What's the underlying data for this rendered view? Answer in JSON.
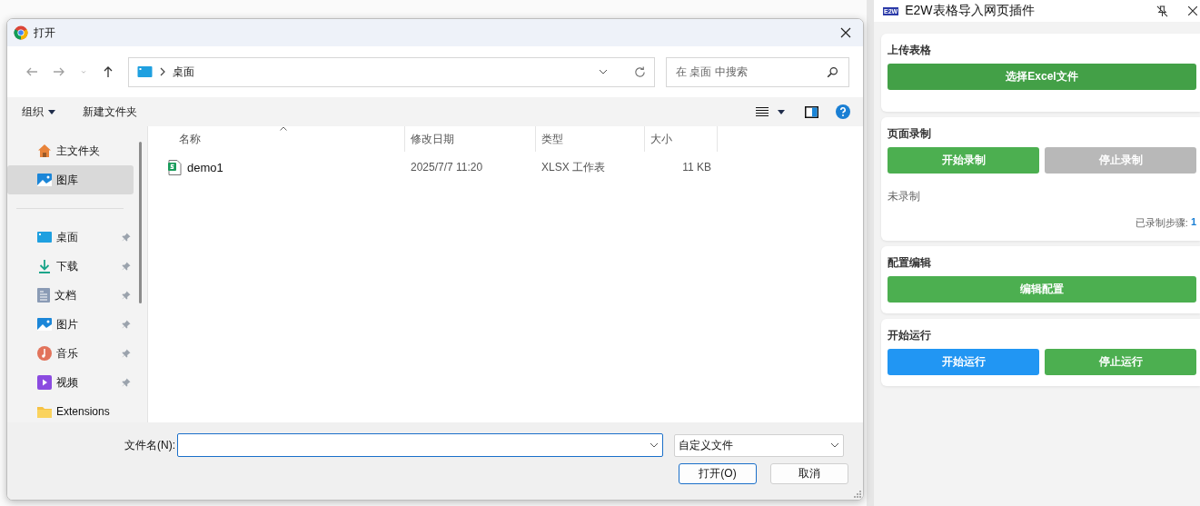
{
  "dialog": {
    "title": "打开",
    "navigation": [
      {
        "kind": "back",
        "disabled": true
      },
      {
        "kind": "forward",
        "disabled": true
      },
      {
        "kind": "recent",
        "disabled": true
      },
      {
        "kind": "up",
        "disabled": false
      }
    ],
    "address": {
      "path": [
        "桌面"
      ]
    },
    "search": {
      "placeholder": "在 桌面 中搜索"
    },
    "toolbar": {
      "organize": "组织",
      "new_folder": "新建文件夹"
    },
    "sidebar": {
      "items": [
        {
          "label": "主文件夹",
          "kind": "home",
          "pinned": false,
          "selected": false
        },
        {
          "label": "图库",
          "kind": "gallery",
          "pinned": false,
          "selected": true
        },
        {
          "label": "桌面",
          "kind": "desktop",
          "pinned": true,
          "selected": false
        },
        {
          "label": "下载",
          "kind": "download",
          "pinned": true,
          "selected": false
        },
        {
          "label": "文档",
          "kind": "documents",
          "pinned": true,
          "selected": false
        },
        {
          "label": "图片",
          "kind": "pictures",
          "pinned": true,
          "selected": false
        },
        {
          "label": "音乐",
          "kind": "music",
          "pinned": true,
          "selected": false
        },
        {
          "label": "视频",
          "kind": "videos",
          "pinned": true,
          "selected": false
        },
        {
          "label": "Extensions",
          "kind": "folder",
          "pinned": false,
          "selected": false
        }
      ]
    },
    "table": {
      "columns": [
        {
          "label": "名称",
          "sorted": true
        },
        {
          "label": "修改日期",
          "sorted": false
        },
        {
          "label": "类型",
          "sorted": false
        },
        {
          "label": "大小",
          "sorted": false
        }
      ],
      "rows": [
        {
          "name": "demo1",
          "modified": "2025/7/7 11:20",
          "type": "XLSX 工作表",
          "size": "11 KB",
          "selected": false
        }
      ]
    },
    "footer": {
      "filename_label": "文件名(N):",
      "filter": "自定义文件",
      "buttons": [
        {
          "label": "打开(O)",
          "default": true
        },
        {
          "label": "取消",
          "default": false
        }
      ]
    }
  },
  "panel": {
    "logo_text": "E2W",
    "title": "E2W表格导入网页插件",
    "sections": [
      {
        "title": "上传表格",
        "buttons": [
          {
            "label": "选择Excel文件",
            "color": "#43a047"
          }
        ]
      },
      {
        "title": "页面录制",
        "buttons": [
          {
            "label": "开始录制",
            "color": "#4caf50"
          },
          {
            "label": "停止录制",
            "color": "#b8b8b8"
          }
        ],
        "status": "未录制",
        "steps_label": "已录制步骤:",
        "steps_count": "1"
      },
      {
        "title": "配置编辑",
        "buttons": [
          {
            "label": "编辑配置",
            "color": "#4caf50"
          }
        ]
      },
      {
        "title": "开始运行",
        "buttons": [
          {
            "label": "开始运行",
            "color": "#2196f3"
          },
          {
            "label": "停止运行",
            "color": "#4caf50"
          }
        ]
      }
    ]
  }
}
